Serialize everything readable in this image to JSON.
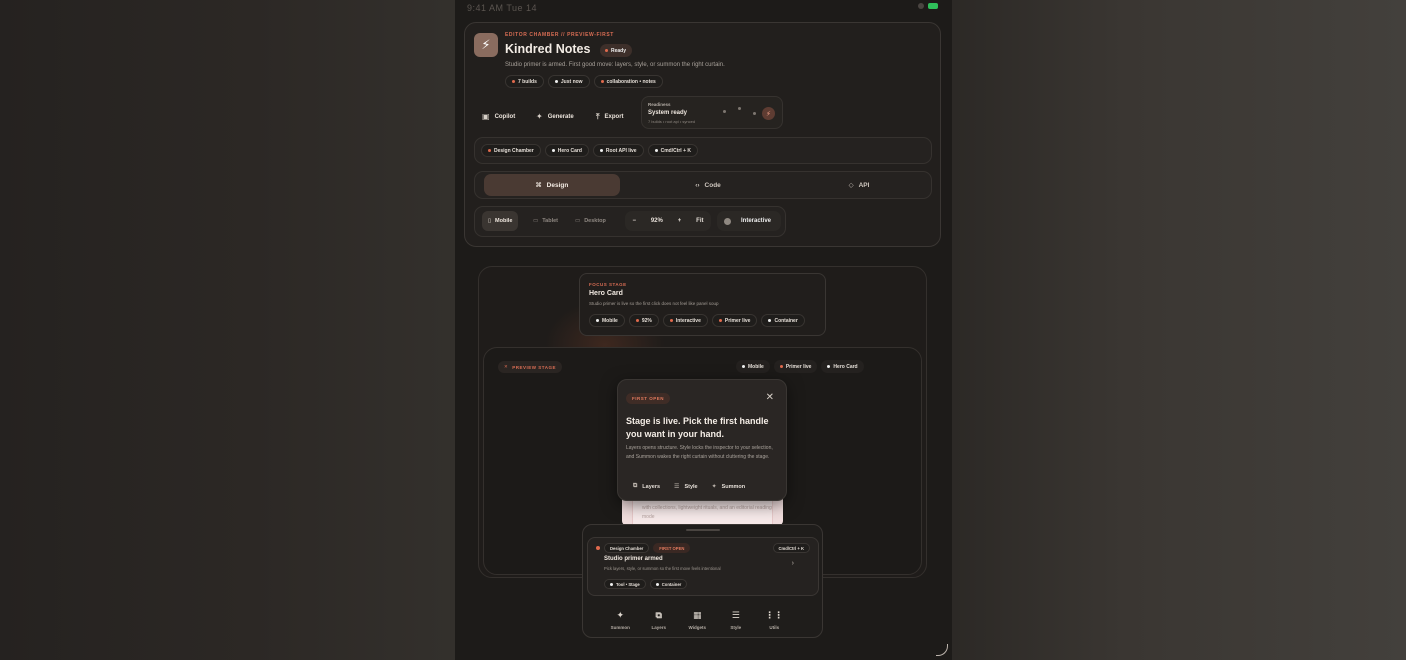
{
  "status": {
    "time": "9:41 AM Tue 14"
  },
  "header": {
    "eyebrow": "EDITOR CHAMBER // PREVIEW-FIRST",
    "title": "Kindred Notes",
    "status_pill": "Ready",
    "subtitle": "Studio primer is armed. First good move: layers, style, or summon the right curtain.",
    "meta_chips": [
      "7 builds",
      "Just now",
      "collaboration • notes"
    ]
  },
  "actions": {
    "copilot": "Copilot",
    "generate": "Generate",
    "export": "Export"
  },
  "readiness": {
    "label": "Readiness",
    "value": "System ready",
    "meta": "7 builds • root api • synced"
  },
  "breadcrumbs": [
    "Design Chamber",
    "Hero Card",
    "Root API live",
    "Cmd/Ctrl + K"
  ],
  "main_tabs": [
    {
      "label": "Design",
      "icon": "⌘"
    },
    {
      "label": "Code",
      "icon": "‹›"
    },
    {
      "label": "API",
      "icon": "◇"
    }
  ],
  "devices": {
    "mobile": "Mobile",
    "tablet": "Tablet",
    "desktop": "Desktop"
  },
  "zoom": {
    "minus": "−",
    "value": "92%",
    "plus": "+",
    "fit": "Fit"
  },
  "interactive_label": "Interactive",
  "focus_stage": {
    "eyebrow": "FOCUS STAGE",
    "title": "Hero Card",
    "subtitle": "Studio primer is live so the first click does not feel like panel soup",
    "chips": [
      "Mobile",
      "92%",
      "Interactive",
      "Primer live",
      "Container"
    ]
  },
  "preview_stage": {
    "label": "PREVIEW STAGE",
    "chips": [
      "Mobile",
      "Primer live",
      "Hero Card"
    ]
  },
  "first_open_modal": {
    "badge": "FIRST OPEN",
    "heading": "Stage is live. Pick the first handle you want in your hand.",
    "body": "Layers opens structure. Style locks the inspector to your selection, and Summon wakes the right curtain without cluttering the stage.",
    "actions": [
      "Layers",
      "Style",
      "Summon"
    ]
  },
  "pink_card_text": "with collections, lightweight rituals, and an editorial reading mode",
  "sheet": {
    "chips": [
      "Design Chamber",
      "FIRST OPEN"
    ],
    "title": "Studio primer armed",
    "subtitle": "Pick layers, style, or summon so the first move feels intentional",
    "bottom_chips": [
      "Tool • Stage",
      "Container"
    ]
  },
  "tab_bar": [
    {
      "label": "Summon",
      "icon": "✦"
    },
    {
      "label": "Layers",
      "icon": "⧉"
    },
    {
      "label": "Widgets",
      "icon": "▦"
    },
    {
      "label": "Style",
      "icon": "☰"
    },
    {
      "label": "Utils",
      "icon": "⋮⋮"
    }
  ],
  "colors": {
    "accent": "#d96d54",
    "panel": "#221f1d",
    "active_tab": "#4a3a33"
  }
}
